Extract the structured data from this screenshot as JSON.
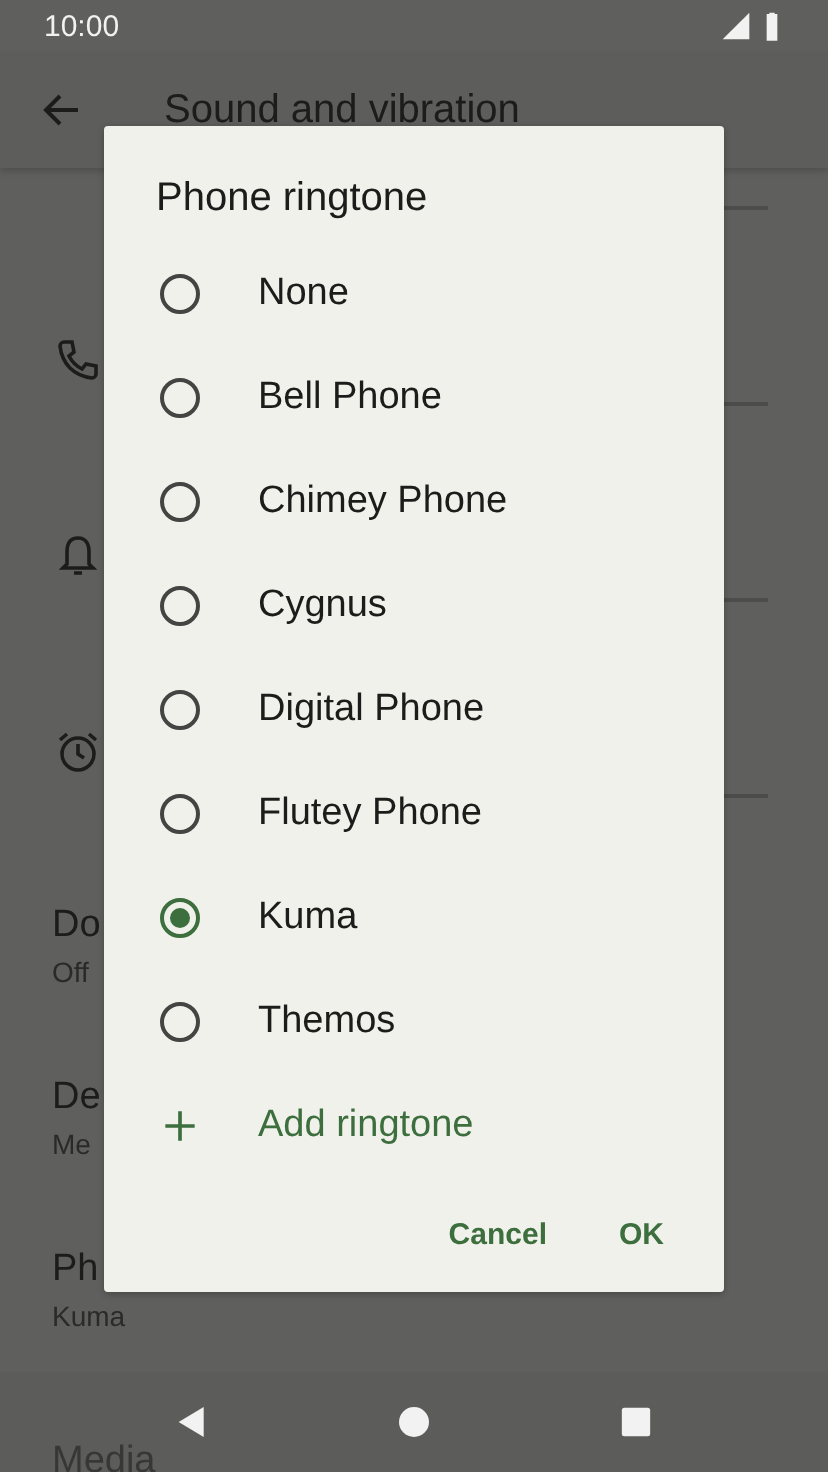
{
  "status_bar": {
    "time": "10:00"
  },
  "app_bar": {
    "title": "Sound and vibration"
  },
  "volume_rows": [
    {
      "kind": "none"
    },
    {
      "kind": "phone"
    },
    {
      "kind": "bell"
    },
    {
      "kind": "alarm"
    }
  ],
  "settings_rows": [
    {
      "title": "Do",
      "subtitle": "Off"
    },
    {
      "title": "De",
      "subtitle": "Me"
    },
    {
      "title": "Ph",
      "subtitle": "Kuma"
    },
    {
      "title": "Media"
    }
  ],
  "dialog": {
    "title": "Phone ringtone",
    "options": [
      {
        "label": "None",
        "selected": false
      },
      {
        "label": "Bell Phone",
        "selected": false
      },
      {
        "label": "Chimey Phone",
        "selected": false
      },
      {
        "label": "Cygnus",
        "selected": false
      },
      {
        "label": "Digital Phone",
        "selected": false
      },
      {
        "label": "Flutey Phone",
        "selected": false
      },
      {
        "label": "Kuma",
        "selected": true
      },
      {
        "label": "Themos",
        "selected": false
      }
    ],
    "add_action": {
      "label": "Add ringtone"
    },
    "buttons": [
      {
        "label": "Cancel"
      },
      {
        "label": "OK"
      }
    ]
  }
}
